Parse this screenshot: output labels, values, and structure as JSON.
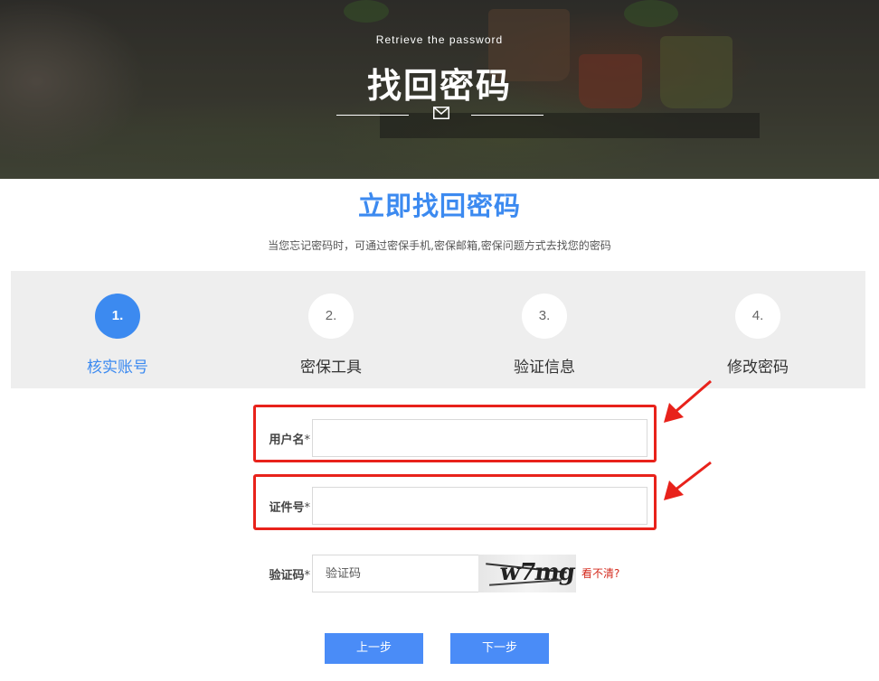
{
  "banner": {
    "subtitle": "Retrieve the password",
    "title": "找回密码"
  },
  "main": {
    "title": "立即找回密码",
    "description": "当您忘记密码时，可通过密保手机,密保邮箱,密保问题方式去找您的密码"
  },
  "steps": [
    {
      "number": "1.",
      "label": "核实账号",
      "active": true
    },
    {
      "number": "2.",
      "label": "密保工具",
      "active": false
    },
    {
      "number": "3.",
      "label": "验证信息",
      "active": false
    },
    {
      "number": "4.",
      "label": "修改密码",
      "active": false
    }
  ],
  "form": {
    "username": {
      "label": "用户名",
      "required_mark": "*",
      "value": "",
      "placeholder": ""
    },
    "id_number": {
      "label": "证件号",
      "required_mark": "*",
      "value": "",
      "placeholder": ""
    },
    "captcha": {
      "label": "验证码",
      "required_mark": "*",
      "value": "",
      "placeholder": "验证码",
      "image_text": "w7mg",
      "refresh_text": "看不清?"
    }
  },
  "buttons": {
    "prev": "上一步",
    "next": "下一步"
  },
  "colors": {
    "accent": "#3c8af0",
    "button": "#4a8cf7",
    "annotation": "#e8221b",
    "link": "#d42a1d"
  }
}
